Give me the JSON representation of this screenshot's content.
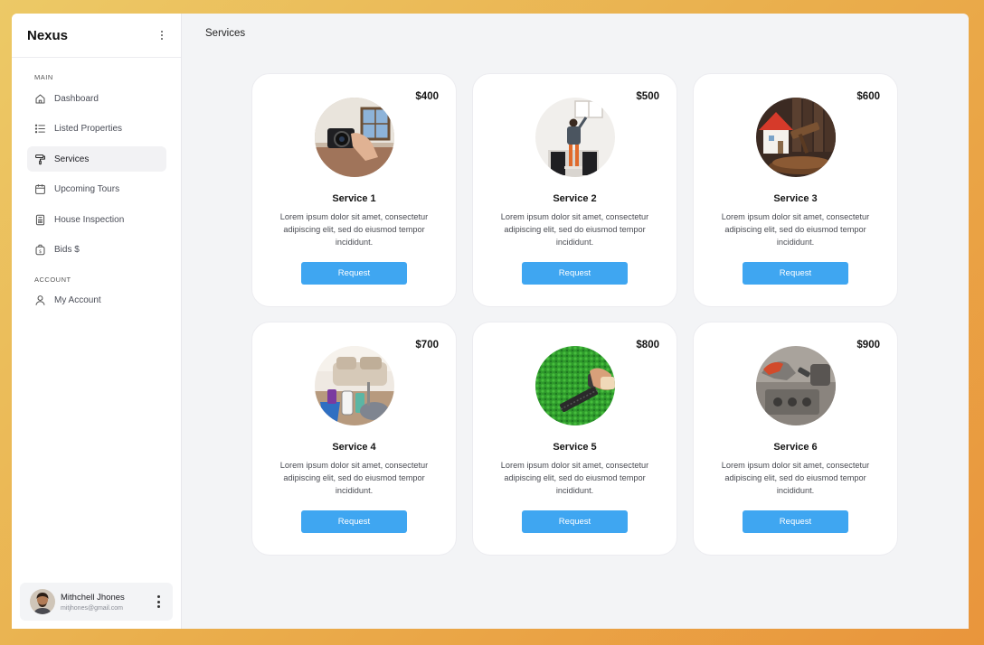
{
  "app": {
    "brand": "Nexus"
  },
  "sidebar": {
    "sections": [
      {
        "label": "MAIN"
      },
      {
        "label": "ACCOUNT"
      }
    ],
    "items": [
      {
        "label": "Dashboard",
        "icon": "home-icon"
      },
      {
        "label": "Listed Properties",
        "icon": "list-icon"
      },
      {
        "label": "Services",
        "icon": "paint-roller-icon",
        "active": true
      },
      {
        "label": "Upcoming Tours",
        "icon": "calendar-icon"
      },
      {
        "label": "House Inspection",
        "icon": "calculator-icon"
      },
      {
        "label": "Bids $",
        "icon": "money-bag-icon"
      }
    ],
    "account_items": [
      {
        "label": "My Account",
        "icon": "user-icon"
      }
    ],
    "user": {
      "name": "Mithchell Jhones",
      "email": "mitjhones@gmail.com"
    }
  },
  "page": {
    "title": "Services"
  },
  "services": [
    {
      "title": "Service 1",
      "price": "$400",
      "description": "Lorem ipsum dolor sit amet, consectetur adipiscing elit, sed do eiusmod tempor incididunt.",
      "button": "Request",
      "image": "camera-in-room"
    },
    {
      "title": "Service 2",
      "price": "$500",
      "description": "Lorem ipsum dolor sit amet, consectetur adipiscing elit, sed do eiusmod tempor incididunt.",
      "button": "Request",
      "image": "painter-on-ladder"
    },
    {
      "title": "Service 3",
      "price": "$600",
      "description": "Lorem ipsum dolor sit amet, consectetur adipiscing elit, sed do eiusmod tempor incididunt.",
      "button": "Request",
      "image": "house-model-and-gavel"
    },
    {
      "title": "Service 4",
      "price": "$700",
      "description": "Lorem ipsum dolor sit amet, consectetur adipiscing elit, sed do eiusmod tempor incididunt.",
      "button": "Request",
      "image": "cleaning-supplies-in-living-room"
    },
    {
      "title": "Service 5",
      "price": "$800",
      "description": "Lorem ipsum dolor sit amet, consectetur adipiscing elit, sed do eiusmod tempor incididunt.",
      "button": "Request",
      "image": "hedge-trimming"
    },
    {
      "title": "Service 6",
      "price": "$900",
      "description": "Lorem ipsum dolor sit amet, consectetur adipiscing elit, sed do eiusmod tempor incididunt.",
      "button": "Request",
      "image": "appliance-repair"
    }
  ],
  "colors": {
    "accent": "#3fa6f1",
    "background": "#f3f4f6",
    "frame": "#eaae4c"
  }
}
